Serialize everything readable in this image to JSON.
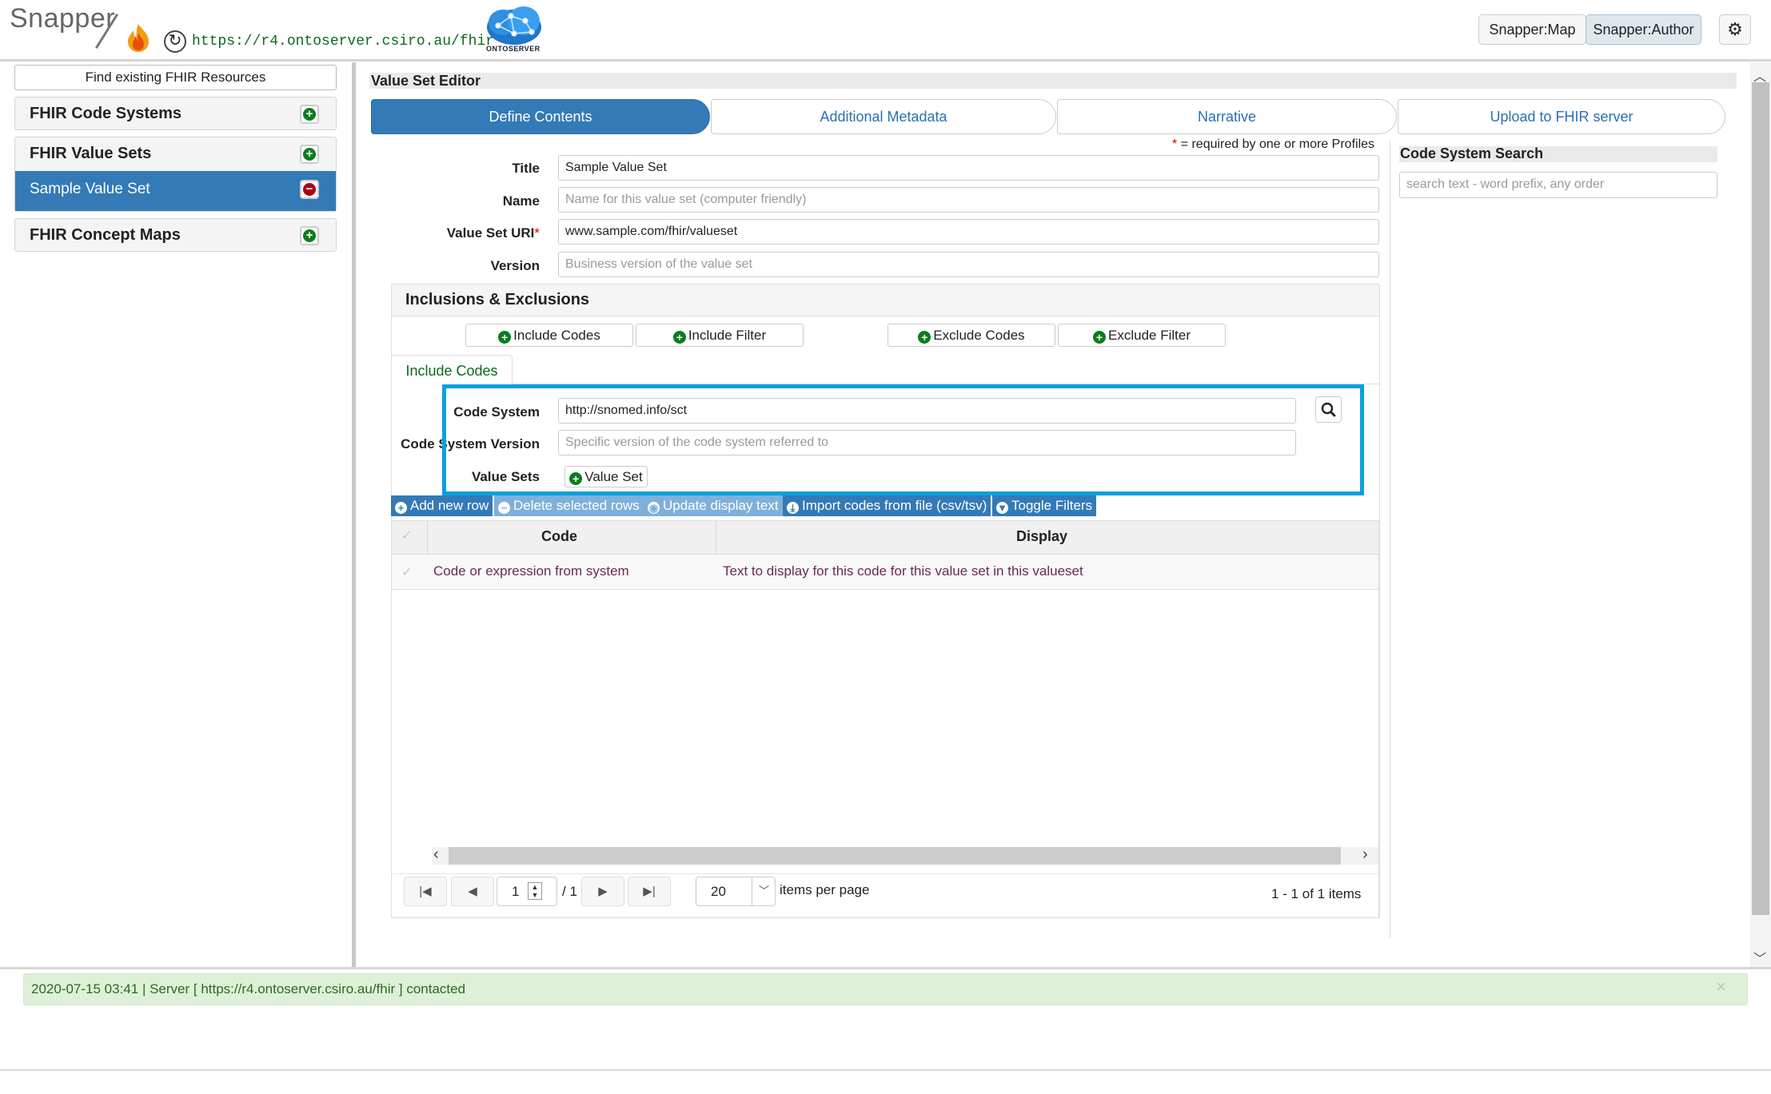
{
  "header": {
    "brand": "Snapper",
    "server_url": "https://r4.ontoserver.csiro.au/fhir",
    "logo_label": "ONTOSERVER",
    "nav": {
      "map_label": "Snapper:Map",
      "author_label": "Snapper:Author"
    },
    "settings_icon": "gear-icon"
  },
  "sidebar": {
    "find_label": "Find existing FHIR Resources",
    "sections": {
      "code_systems": "FHIR Code Systems",
      "value_sets": "FHIR Value Sets",
      "concept_maps": "FHIR Concept Maps"
    },
    "selected_value_set": "Sample Value Set"
  },
  "editor": {
    "title": "Value Set Editor",
    "tabs": {
      "define": "Define Contents",
      "metadata": "Additional Metadata",
      "narrative": "Narrative",
      "upload": "Upload to FHIR server"
    },
    "required_note_star": "*",
    "required_note": "= required by one or more Profiles",
    "fields": {
      "title_label": "Title",
      "title_value": "Sample Value Set",
      "name_label": "Name",
      "name_placeholder": "Name for this value set (computer friendly)",
      "uri_label": "Value Set URI",
      "uri_star": "*",
      "uri_value": "www.sample.com/fhir/valueset",
      "version_label": "Version",
      "version_placeholder": "Business version of the value set"
    }
  },
  "code_system_search": {
    "title": "Code System Search",
    "placeholder": "search text - word prefix, any order"
  },
  "inclusions": {
    "title": "Inclusions & Exclusions",
    "buttons": {
      "include_codes": "Include Codes",
      "include_filter": "Include Filter",
      "exclude_codes": "Exclude Codes",
      "exclude_filter": "Exclude Filter"
    },
    "active_tab": "Include Codes",
    "code_system_label": "Code System",
    "code_system_value": "http://snomed.info/sct",
    "cs_version_label": "Code System Version",
    "cs_version_placeholder": "Specific version of the code system referred to",
    "value_sets_label": "Value Sets",
    "value_set_button": "Value Set"
  },
  "grid_toolbar": {
    "add_row": "Add new row",
    "delete_rows": "Delete selected rows",
    "update_display": "Update display text",
    "import_codes": "Import codes from file (csv/tsv)",
    "toggle_filters": "Toggle Filters"
  },
  "grid": {
    "columns": [
      "Code",
      "Display"
    ],
    "rows": [
      {
        "code": "Code or expression from system",
        "display": "Text to display for this code for this value set in this valueset"
      }
    ]
  },
  "pager": {
    "page": "1",
    "total_pages": "/ 1",
    "page_size": "20",
    "per_page_label": "items per page",
    "summary": "1 - 1 of 1 items"
  },
  "status": {
    "message": "2020-07-15 03:41 | Server [ https://r4.ontoserver.csiro.au/fhir ] contacted",
    "close": "×"
  },
  "colors": {
    "primary": "#337ab7",
    "add_green": "#0a7d1f",
    "remove_red": "#b00012",
    "highlight": "#09a0dd",
    "status_bg": "#dff0d8"
  }
}
